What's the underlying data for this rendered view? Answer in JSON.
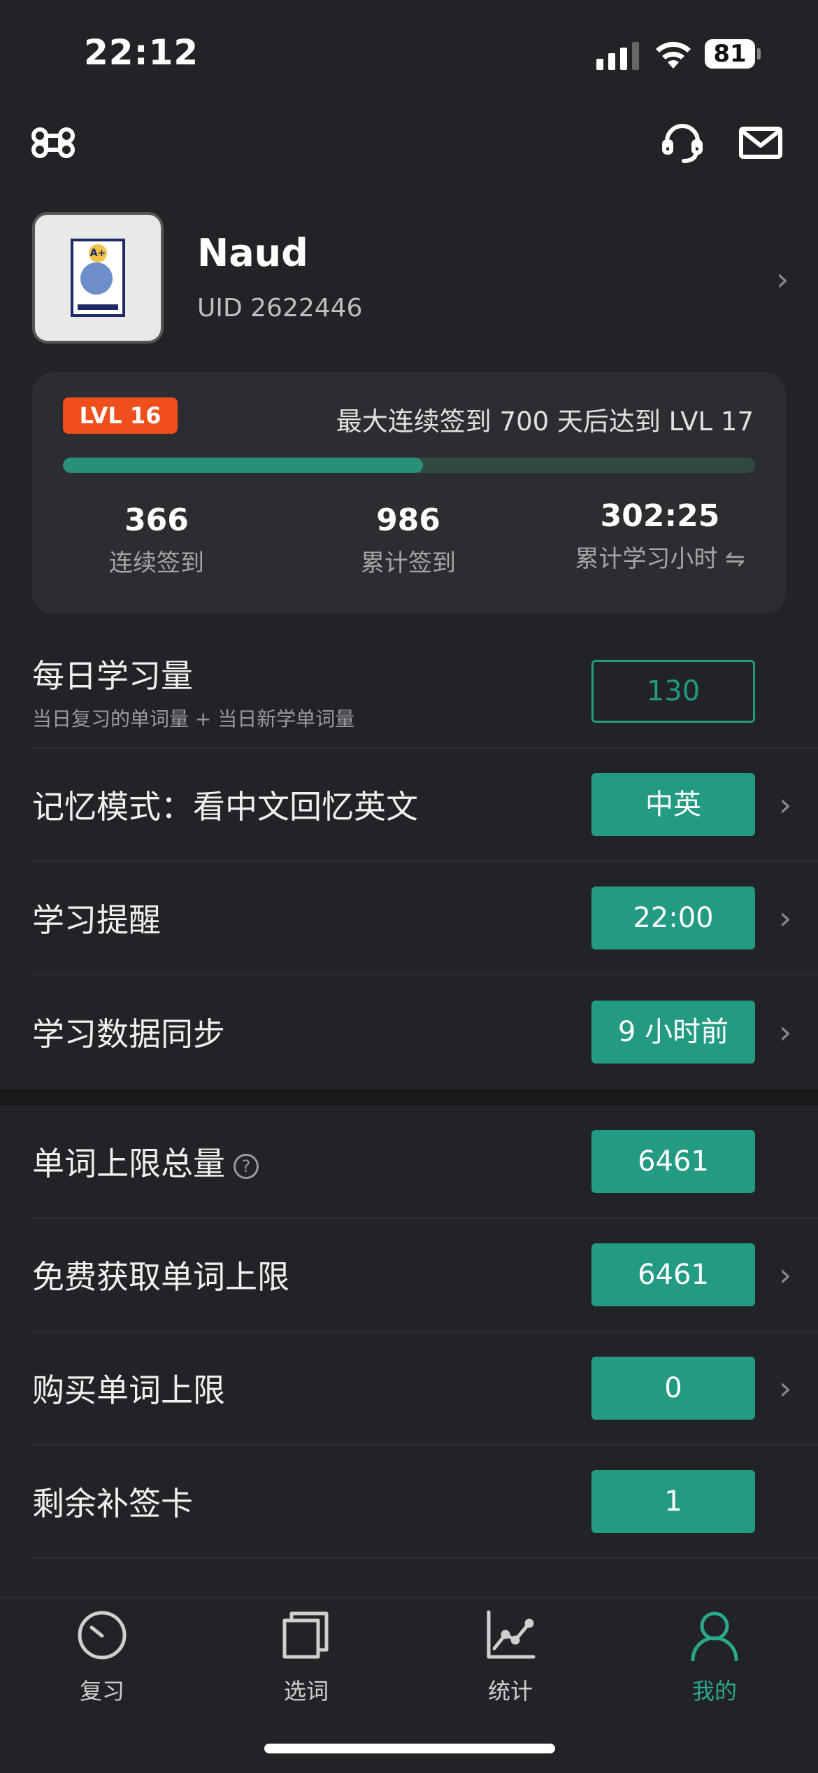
{
  "status": {
    "time": "22:12",
    "battery": "81"
  },
  "header": {
    "menu_icon": "command-icon",
    "support_icon": "headset-icon",
    "mail_icon": "mail-icon"
  },
  "profile": {
    "name": "Naud",
    "uid": "UID 2622446"
  },
  "level": {
    "badge": "LVL 16",
    "note": "最大连续签到 700 天后达到 LVL 17",
    "progress_percent": 52,
    "stats": [
      {
        "value": "366",
        "label": "连续签到"
      },
      {
        "value": "986",
        "label": "累计签到"
      },
      {
        "value": "302:25",
        "label": "累计学习小时 ⇋"
      }
    ]
  },
  "settings": {
    "daily": {
      "label": "每日学习量",
      "sub": "当日复习的单词量 + 当日新学单词量",
      "value": "130"
    },
    "memory": {
      "label": "记忆模式：看中文回忆英文",
      "value": "中英"
    },
    "reminder": {
      "label": "学习提醒",
      "value": "22:00"
    },
    "sync": {
      "label": "学习数据同步",
      "value": "9 小时前"
    }
  },
  "limits": {
    "total": {
      "label": "单词上限总量",
      "help": "?",
      "value": "6461"
    },
    "free": {
      "label": "免费获取单词上限",
      "value": "6461"
    },
    "buy": {
      "label": "购买单词上限",
      "value": "0"
    },
    "cards": {
      "label": "剩余补签卡",
      "value": "1"
    }
  },
  "tabs": [
    {
      "label": "复习",
      "icon": "gauge-icon"
    },
    {
      "label": "选词",
      "icon": "cards-icon"
    },
    {
      "label": "统计",
      "icon": "chart-icon"
    },
    {
      "label": "我的",
      "icon": "person-icon",
      "active": true
    }
  ],
  "colors": {
    "accent": "#239a82",
    "badge": "#f04e1b",
    "background": "#222326"
  }
}
